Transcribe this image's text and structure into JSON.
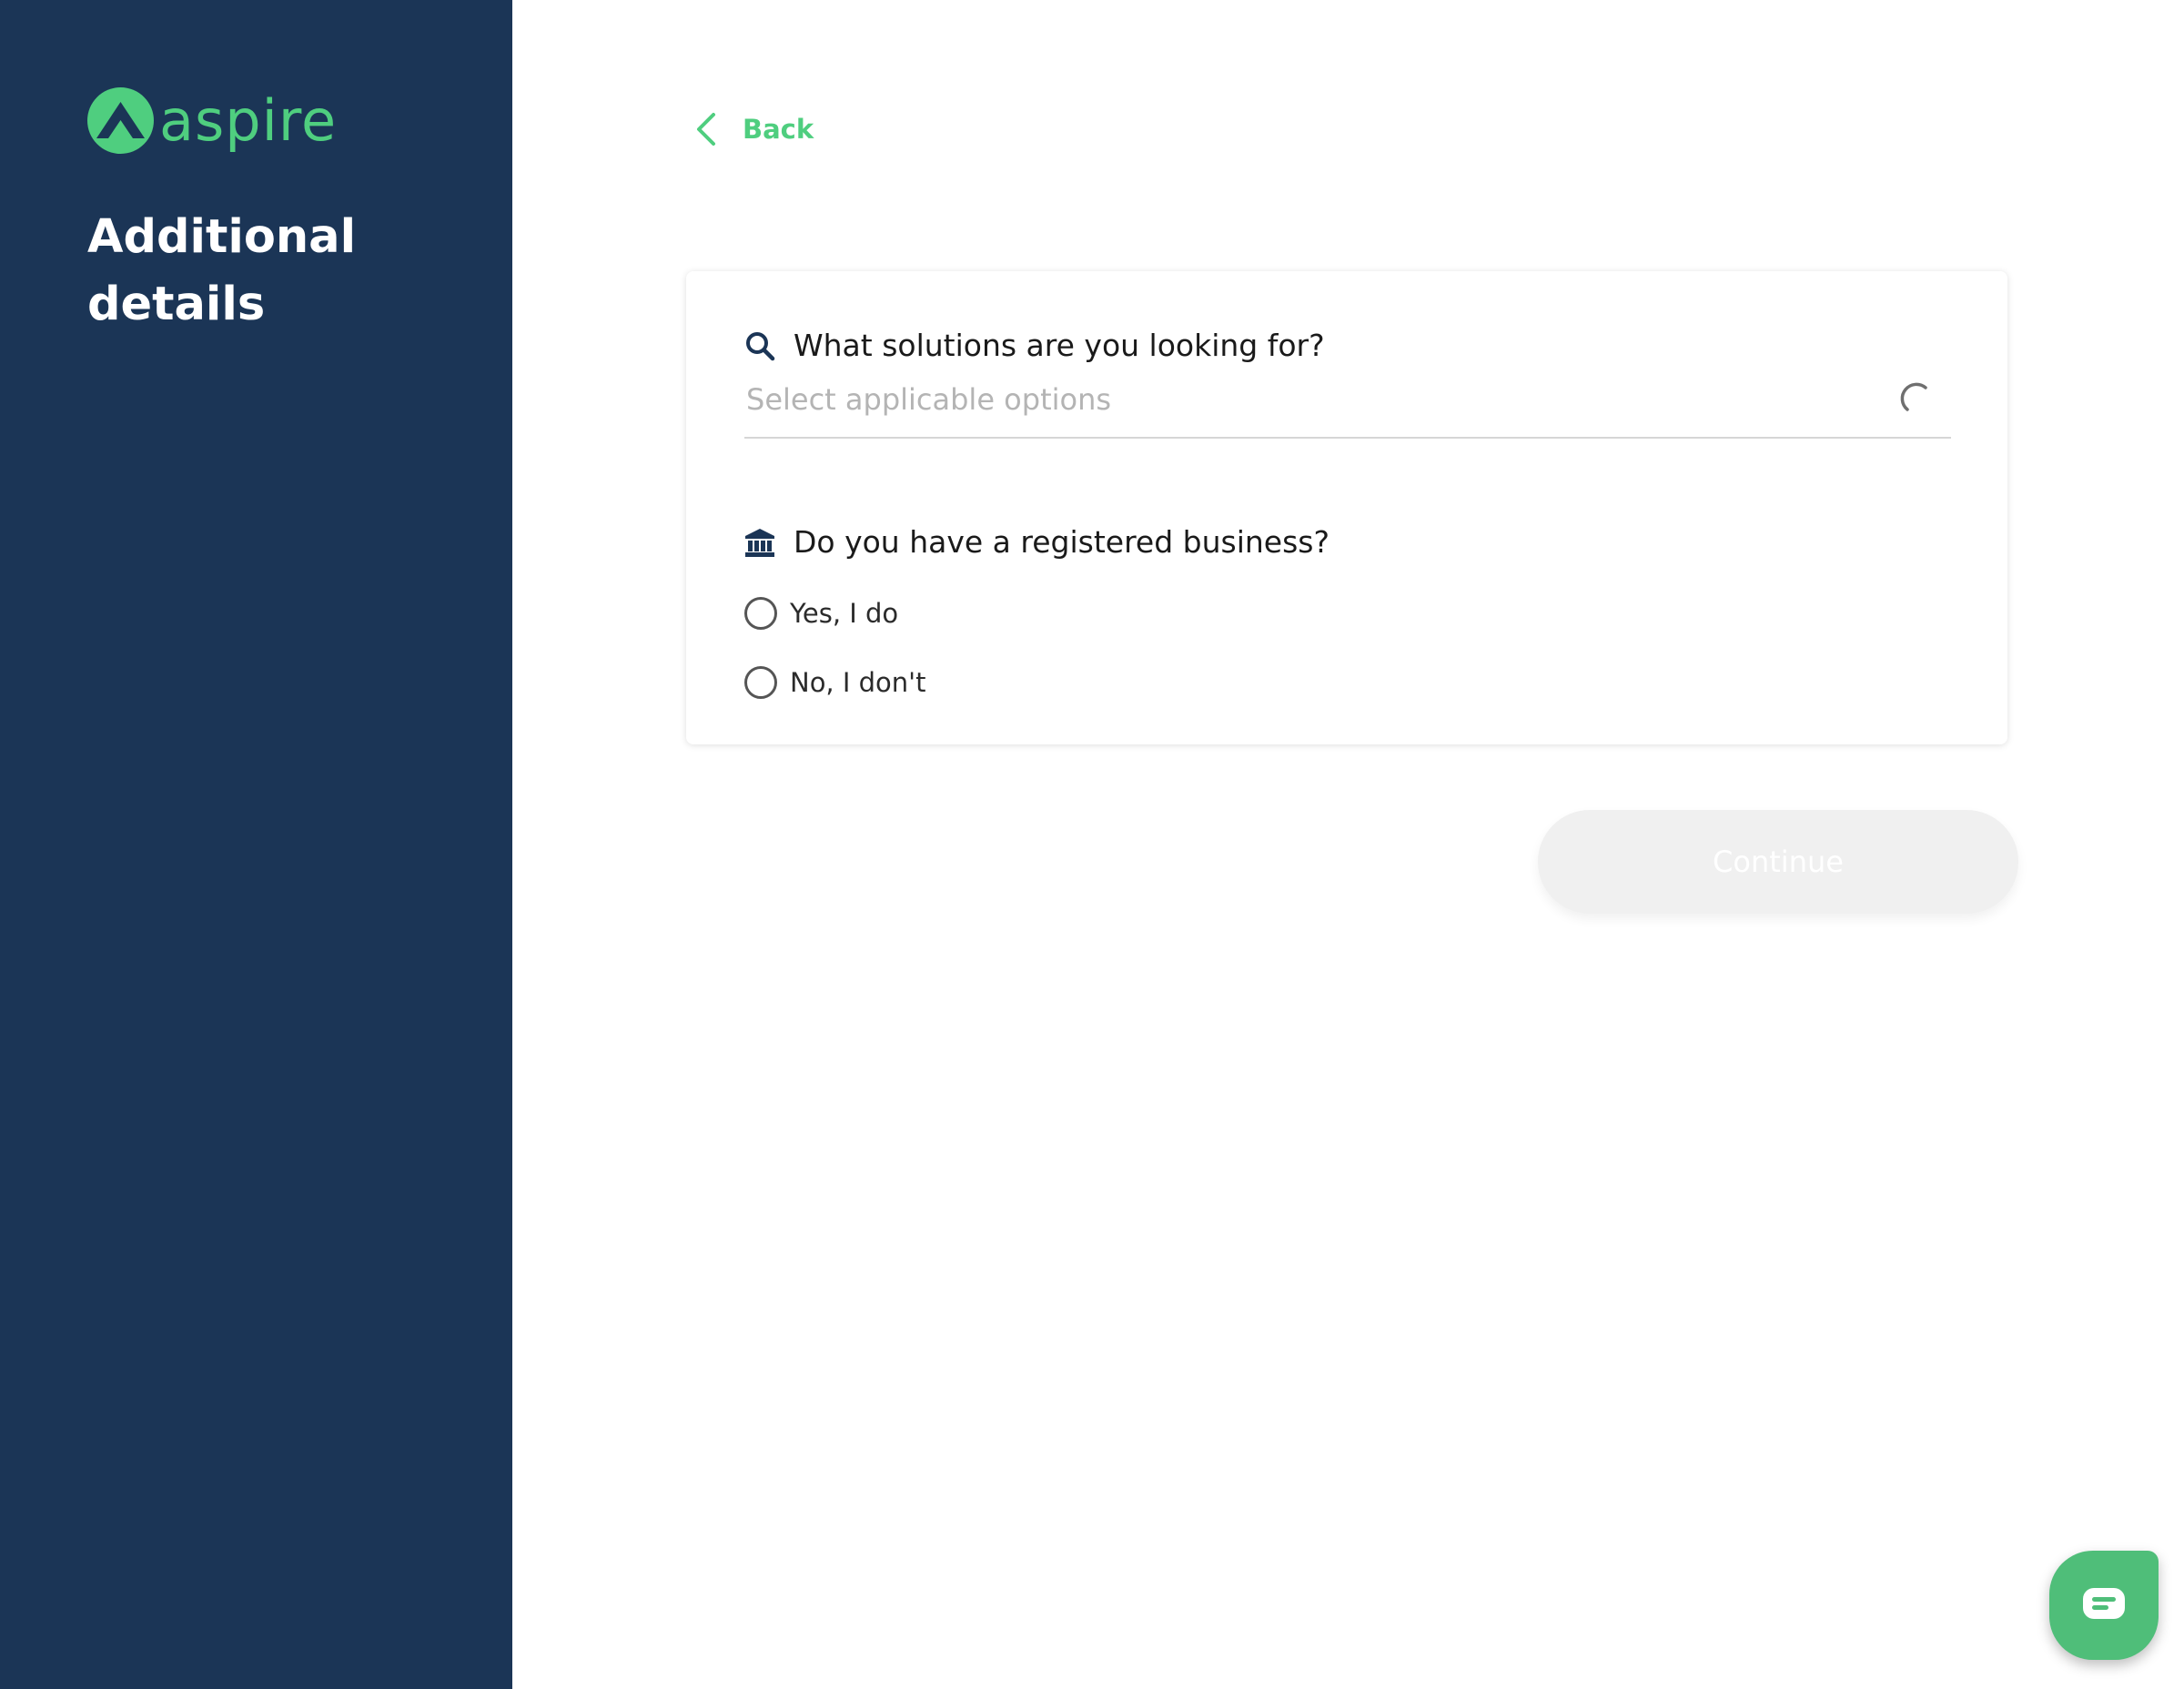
{
  "colors": {
    "sidebar_bg": "#1b3556",
    "brand_green": "#4fce7f",
    "chat_green": "#4fbe79",
    "placeholder_gray": "#b4b4b4",
    "disabled_button_bg": "#f0f0f0"
  },
  "sidebar": {
    "logo": {
      "icon": "aspire-logo-icon",
      "text": "aspire"
    },
    "title": "Additional details"
  },
  "header": {
    "back": {
      "icon": "chevron-left-icon",
      "label": "Back"
    }
  },
  "form": {
    "solutions": {
      "icon": "search-icon",
      "question": "What solutions are you looking for?",
      "placeholder": "Select applicable options",
      "loading_icon": "loading-spinner-icon"
    },
    "business": {
      "icon": "bank-icon",
      "question": "Do you have a registered business?",
      "options": [
        {
          "label": "Yes, I do",
          "selected": false
        },
        {
          "label": "No, I don't",
          "selected": false
        }
      ]
    },
    "continue_label": "Continue",
    "continue_disabled": true
  },
  "chat": {
    "icon": "chat-bubble-icon"
  }
}
